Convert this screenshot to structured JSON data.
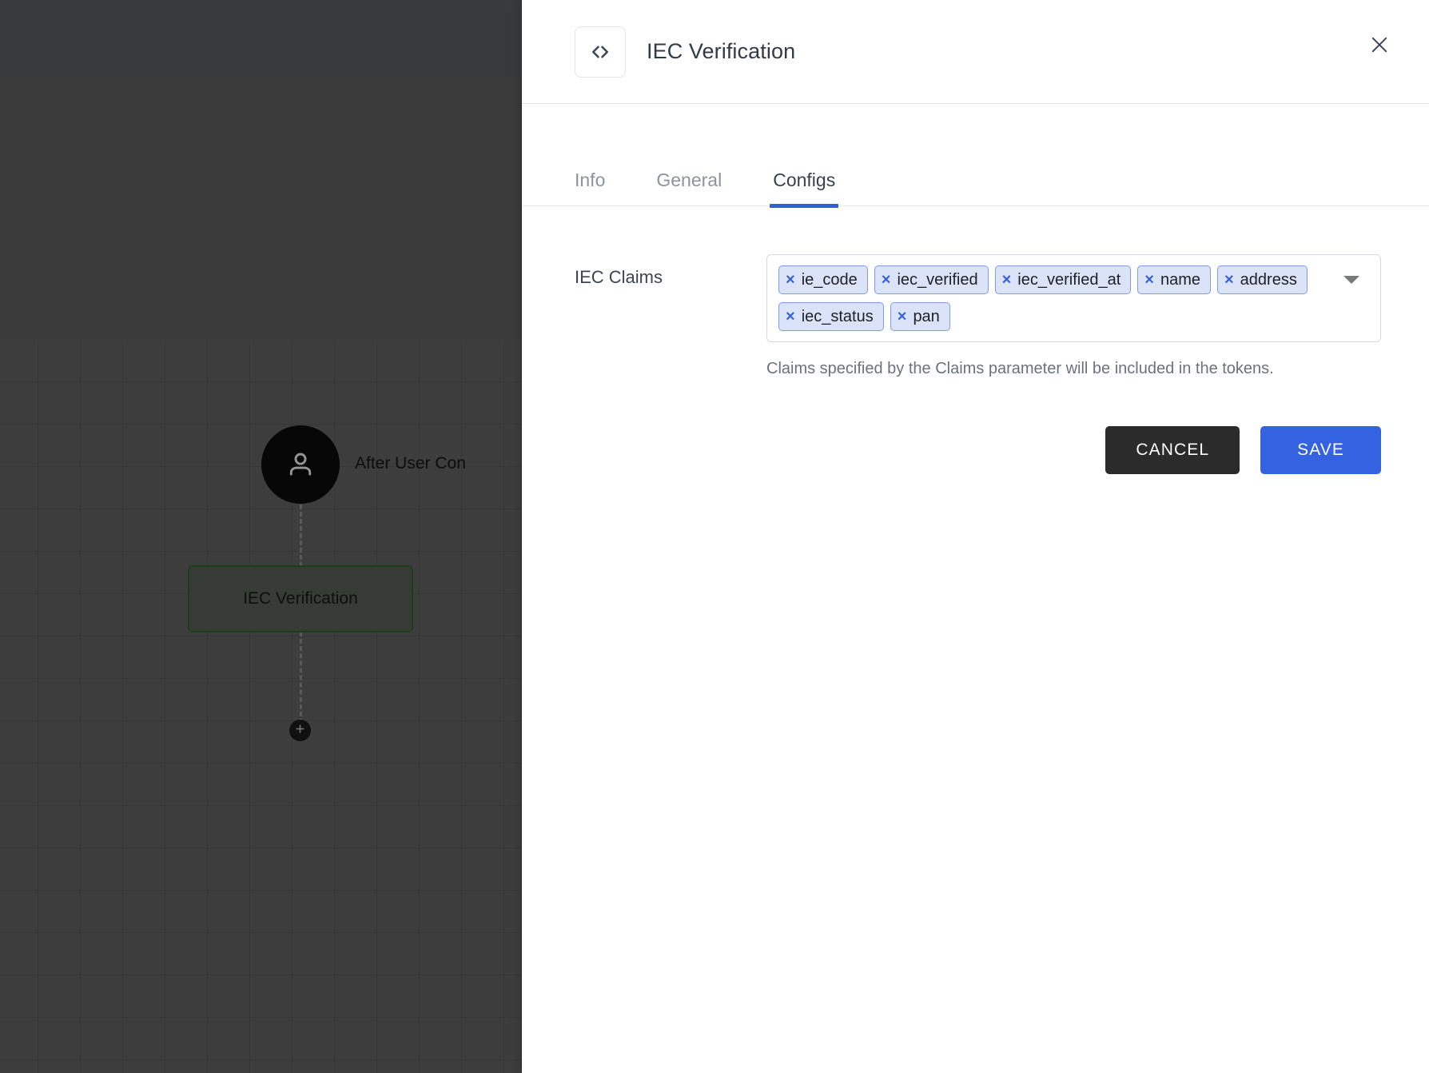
{
  "canvas": {
    "start_node": {
      "icon": "user-icon",
      "label": "After User Con"
    },
    "process_node": {
      "label": "IEC Verification"
    },
    "add_button": {
      "icon": "plus-icon"
    }
  },
  "panel": {
    "header": {
      "icon": "code-brackets-icon",
      "title": "IEC Verification",
      "close_icon": "close-icon"
    },
    "tabs": [
      {
        "label": "Info",
        "active": false
      },
      {
        "label": "General",
        "active": false
      },
      {
        "label": "Configs",
        "active": true
      }
    ],
    "form": {
      "label": "IEC Claims",
      "chips": [
        "ie_code",
        "iec_verified",
        "iec_verified_at",
        "name",
        "address",
        "iec_status",
        "pan"
      ],
      "chip_remove_glyph": "×",
      "dropdown_icon": "chevron-down-icon",
      "helper_text": "Claims specified by the Claims parameter will be included in the tokens."
    },
    "actions": {
      "cancel_label": "CANCEL",
      "save_label": "SAVE"
    }
  },
  "colors": {
    "accent_blue": "#3562e0",
    "tab_active_underline": "#2f5fd0",
    "chip_background": "#dbe3f8",
    "chip_border": "#7f9ae8",
    "chip_x": "#3761d8",
    "cancel_button": "#2b2b2b",
    "node_border_green": "#2e6b30"
  }
}
